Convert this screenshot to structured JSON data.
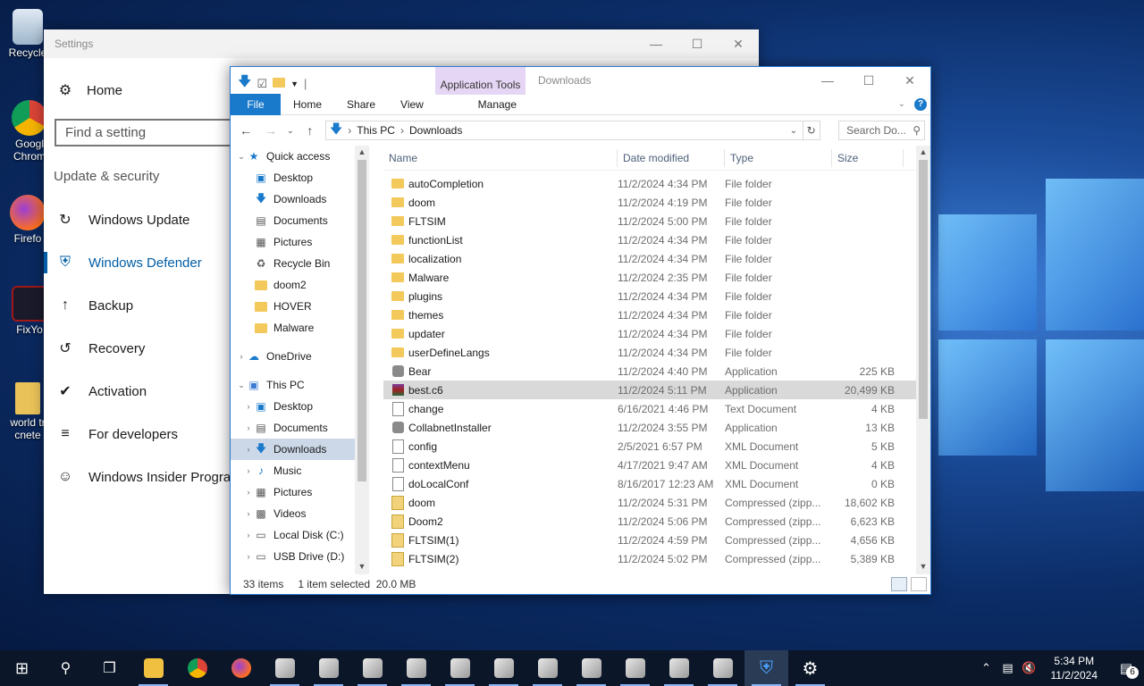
{
  "desktop": {
    "icons": [
      {
        "label": "Recycle"
      },
      {
        "label": "Googl\nChrom"
      },
      {
        "label": "Firefo"
      },
      {
        "label": "FixYo"
      },
      {
        "label": "world tr\ncnete"
      }
    ]
  },
  "settings": {
    "title": "Settings",
    "home_label": "Home",
    "search_placeholder": "Find a setting",
    "section_label": "Update & security",
    "nav": [
      {
        "label": "Windows Update",
        "icon": "sync-icon"
      },
      {
        "label": "Windows Defender",
        "icon": "shield-icon",
        "active": true
      },
      {
        "label": "Backup",
        "icon": "backup-arrow-icon"
      },
      {
        "label": "Recovery",
        "icon": "recovery-icon"
      },
      {
        "label": "Activation",
        "icon": "checkmark-circle-icon"
      },
      {
        "label": "For developers",
        "icon": "developer-tools-icon"
      },
      {
        "label": "Windows Insider Program",
        "icon": "insider-person-icon"
      }
    ]
  },
  "explorer": {
    "window_title": "Downloads",
    "contextual_tab_group": "Application Tools",
    "ribbon_tabs": [
      "File",
      "Home",
      "Share",
      "View",
      "Manage"
    ],
    "breadcrumb": [
      "This PC",
      "Downloads"
    ],
    "search_placeholder": "Search Do...",
    "nav_pane": [
      {
        "label": "Quick access",
        "icon": "star-icon",
        "level": 0,
        "expanded": true
      },
      {
        "label": "Desktop",
        "icon": "desktop-icon",
        "level": 1,
        "pinned": true
      },
      {
        "label": "Downloads",
        "icon": "download-icon",
        "level": 1,
        "pinned": true
      },
      {
        "label": "Documents",
        "icon": "documents-icon",
        "level": 1,
        "pinned": true
      },
      {
        "label": "Pictures",
        "icon": "pictures-icon",
        "level": 1,
        "pinned": true
      },
      {
        "label": "Recycle Bin",
        "icon": "recycle-bin-icon",
        "level": 1,
        "pinned": true
      },
      {
        "label": "doom2",
        "icon": "folder-icon",
        "level": 1
      },
      {
        "label": "HOVER",
        "icon": "folder-icon",
        "level": 1
      },
      {
        "label": "Malware",
        "icon": "folder-icon",
        "level": 1
      },
      {
        "label": "OneDrive",
        "icon": "cloud-icon",
        "level": 0,
        "collapsed": true
      },
      {
        "label": "This PC",
        "icon": "computer-icon",
        "level": 0,
        "expanded": true
      },
      {
        "label": "Desktop",
        "icon": "desktop-icon",
        "level": 1,
        "collapsed": true
      },
      {
        "label": "Documents",
        "icon": "documents-icon",
        "level": 1,
        "collapsed": true
      },
      {
        "label": "Downloads",
        "icon": "download-icon",
        "level": 1,
        "collapsed": true,
        "selected": true
      },
      {
        "label": "Music",
        "icon": "music-icon",
        "level": 1,
        "collapsed": true
      },
      {
        "label": "Pictures",
        "icon": "pictures-icon",
        "level": 1,
        "collapsed": true
      },
      {
        "label": "Videos",
        "icon": "videos-icon",
        "level": 1,
        "collapsed": true
      },
      {
        "label": "Local Disk (C:)",
        "icon": "drive-icon",
        "level": 1,
        "collapsed": true
      },
      {
        "label": "USB Drive (D:)",
        "icon": "usb-drive-icon",
        "level": 1,
        "collapsed": true
      }
    ],
    "columns": [
      "Name",
      "Date modified",
      "Type",
      "Size"
    ],
    "files": [
      {
        "name": "autoCompletion",
        "date": "11/2/2024 4:34 PM",
        "type": "File folder",
        "size": "",
        "kind": "folder"
      },
      {
        "name": "doom",
        "date": "11/2/2024 4:19 PM",
        "type": "File folder",
        "size": "",
        "kind": "folder"
      },
      {
        "name": "FLTSIM",
        "date": "11/2/2024 5:00 PM",
        "type": "File folder",
        "size": "",
        "kind": "folder"
      },
      {
        "name": "functionList",
        "date": "11/2/2024 4:34 PM",
        "type": "File folder",
        "size": "",
        "kind": "folder"
      },
      {
        "name": "localization",
        "date": "11/2/2024 4:34 PM",
        "type": "File folder",
        "size": "",
        "kind": "folder"
      },
      {
        "name": "Malware",
        "date": "11/2/2024 2:35 PM",
        "type": "File folder",
        "size": "",
        "kind": "folder"
      },
      {
        "name": "plugins",
        "date": "11/2/2024 4:34 PM",
        "type": "File folder",
        "size": "",
        "kind": "folder"
      },
      {
        "name": "themes",
        "date": "11/2/2024 4:34 PM",
        "type": "File folder",
        "size": "",
        "kind": "folder"
      },
      {
        "name": "updater",
        "date": "11/2/2024 4:34 PM",
        "type": "File folder",
        "size": "",
        "kind": "folder"
      },
      {
        "name": "userDefineLangs",
        "date": "11/2/2024 4:34 PM",
        "type": "File folder",
        "size": "",
        "kind": "folder"
      },
      {
        "name": "Bear",
        "date": "11/2/2024 4:40 PM",
        "type": "Application",
        "size": "225 KB",
        "kind": "app"
      },
      {
        "name": "best.c6",
        "date": "11/2/2024 5:11 PM",
        "type": "Application",
        "size": "20,499 KB",
        "kind": "rar",
        "selected": true
      },
      {
        "name": "change",
        "date": "6/16/2021 4:46 PM",
        "type": "Text Document",
        "size": "4 KB",
        "kind": "doc"
      },
      {
        "name": "CollabnetInstaller",
        "date": "11/2/2024 3:55 PM",
        "type": "Application",
        "size": "13 KB",
        "kind": "app"
      },
      {
        "name": "config",
        "date": "2/5/2021 6:57 PM",
        "type": "XML Document",
        "size": "5 KB",
        "kind": "doc"
      },
      {
        "name": "contextMenu",
        "date": "4/17/2021 9:47 AM",
        "type": "XML Document",
        "size": "4 KB",
        "kind": "doc"
      },
      {
        "name": "doLocalConf",
        "date": "8/16/2017 12:23 AM",
        "type": "XML Document",
        "size": "0 KB",
        "kind": "doc"
      },
      {
        "name": "doom",
        "date": "11/2/2024 5:31 PM",
        "type": "Compressed (zipp...",
        "size": "18,602 KB",
        "kind": "zip"
      },
      {
        "name": "Doom2",
        "date": "11/2/2024 5:06 PM",
        "type": "Compressed (zipp...",
        "size": "6,623 KB",
        "kind": "zip"
      },
      {
        "name": "FLTSIM(1)",
        "date": "11/2/2024 4:59 PM",
        "type": "Compressed (zipp...",
        "size": "4,656 KB",
        "kind": "zip"
      },
      {
        "name": "FLTSIM(2)",
        "date": "11/2/2024 5:02 PM",
        "type": "Compressed (zipp...",
        "size": "5,389 KB",
        "kind": "zip"
      }
    ],
    "status": {
      "count": "33 items",
      "selection": "1 item selected  20.0 MB"
    }
  },
  "taskbar": {
    "time": "5:34 PM",
    "date": "11/2/2024",
    "notification_count": "6"
  }
}
